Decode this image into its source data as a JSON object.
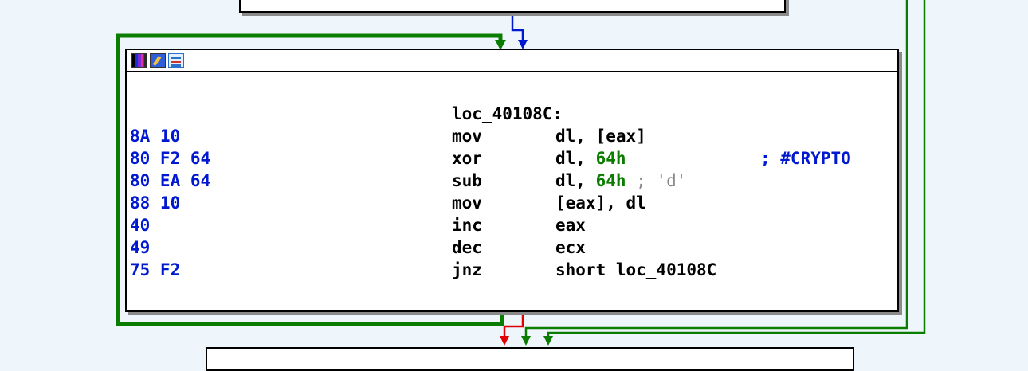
{
  "colors": {
    "background": "#eef6fc",
    "bytes": "#0018d0",
    "number": "#0a7d00",
    "comment": "#8a8a8a",
    "edge_true": "#0a7d00",
    "edge_false": "#e00000",
    "edge_normal": "#0018d0"
  },
  "toolbar_icons": [
    "palette-icon",
    "edit-icon",
    "graph-overview-icon"
  ],
  "node": {
    "label": "loc_40108C:",
    "rows": [
      {
        "bytes": "8A 10",
        "mnemonic": "mov",
        "operand": "dl, [eax]"
      },
      {
        "bytes": "80 F2 64",
        "mnemonic": "xor",
        "operand": "dl, ",
        "num": "64h",
        "comment": "; #CRYPTO"
      },
      {
        "bytes": "80 EA 64",
        "mnemonic": "sub",
        "operand": "dl, ",
        "num": "64h",
        "comment": " ; 'd'"
      },
      {
        "bytes": "88 10",
        "mnemonic": "mov",
        "operand": "[eax], dl"
      },
      {
        "bytes": "40",
        "mnemonic": "inc",
        "operand": "eax"
      },
      {
        "bytes": "49",
        "mnemonic": "dec",
        "operand": "ecx"
      },
      {
        "bytes": "75 F2",
        "mnemonic": "jnz",
        "operand": "short loc_40108C"
      }
    ]
  }
}
